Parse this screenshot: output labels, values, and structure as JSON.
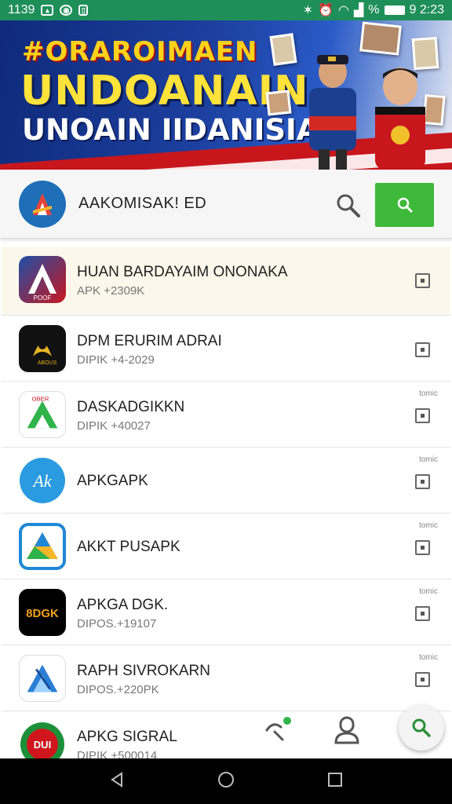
{
  "status_bar": {
    "time_left": "1139",
    "time_right": "9 2:23",
    "percent_symbol": "%"
  },
  "banner": {
    "line1": "#ORAROIMAEN",
    "line2": "UNDOANAIN",
    "line3": "UNOAIN IIDANISIA"
  },
  "search": {
    "title": "AAKOMISAK! ED"
  },
  "apps": [
    {
      "title": "HUAN BARDAYAIM ONONAKA",
      "subtitle": "APK +2309K",
      "small": "",
      "icon": "dark-red-a-icon",
      "icon_text": "POOF"
    },
    {
      "title": "DPM ERURIM ADRAI",
      "subtitle": "DIPIK +4-2029",
      "small": "",
      "icon": "black-gold-emblem-icon",
      "icon_text": "ABOUS"
    },
    {
      "title": "DASKADGIKKN",
      "subtitle": "DIPIK +40027",
      "small": "tomic",
      "icon": "green-triangle-icon",
      "icon_text": "OBER"
    },
    {
      "title": "APKGAPK",
      "subtitle": "",
      "small": "tomic",
      "icon": "blue-circle-ak-icon",
      "icon_text": "Ak"
    },
    {
      "title": "AKKT PUSAPK",
      "subtitle": "",
      "small": "tomic",
      "icon": "drive-triangle-icon",
      "icon_text": ""
    },
    {
      "title": "APKGA DGK.",
      "subtitle": "DIPOS.+19107",
      "small": "tomic",
      "icon": "black-dgk-icon",
      "icon_text": "8DGK"
    },
    {
      "title": "RAPH SIVROKARN",
      "subtitle": "DIPOS.+220PK",
      "small": "tomic",
      "icon": "blue-guitar-icon",
      "icon_text": ""
    },
    {
      "title": "APKG SIGRAL",
      "subtitle": "DIPIK +500014",
      "small": "",
      "icon": "green-red-badge-icon",
      "icon_text": "DUI"
    }
  ],
  "colors": {
    "status_bar": "#1f8f5a",
    "search_button": "#3fb93a",
    "highlight_row": "#fbf7ea"
  }
}
